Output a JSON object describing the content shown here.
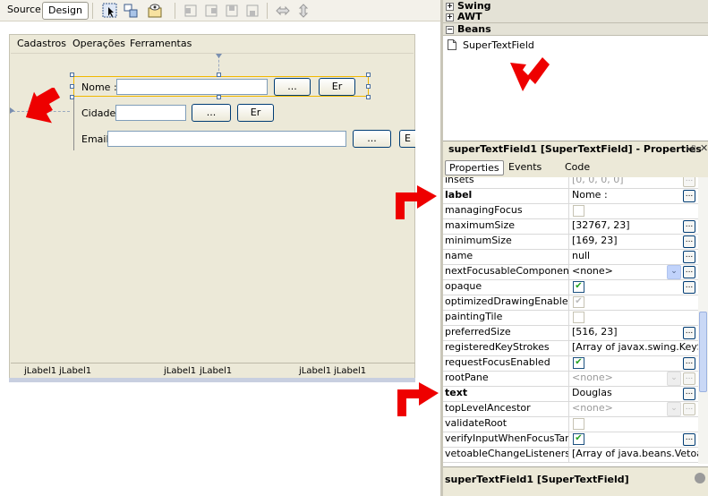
{
  "editor": {
    "tabs": {
      "source": "Source",
      "design": "Design"
    },
    "menu": [
      "Cadastros",
      "Operações",
      "Ferramentas"
    ],
    "form": {
      "rows": [
        {
          "label": "Nome :",
          "button1": "...",
          "button2": "Er"
        },
        {
          "label": "Cidade",
          "button1": "...",
          "button2": "Er"
        },
        {
          "label": "Email",
          "button1": "...",
          "button2": "E"
        }
      ]
    },
    "footer_labels": [
      "jLabel1",
      "jLabel1",
      "jLabel1",
      "jLabel1",
      "jLabel1",
      "jLabel1"
    ]
  },
  "palette": {
    "categories": [
      "Swing",
      "AWT",
      "Beans"
    ],
    "bean_item": "SuperTextField"
  },
  "properties": {
    "title": "superTextField1 [SuperTextField] - Properties",
    "tabs": [
      "Properties",
      "Events",
      "Code"
    ],
    "rows": [
      {
        "name": "insets",
        "value": "[0, 0, 0, 0]",
        "kind": "text",
        "ro": true,
        "ell": true
      },
      {
        "name": "label",
        "value": "Nome :",
        "kind": "text",
        "bold": true,
        "ell": true
      },
      {
        "name": "managingFocus",
        "value": "",
        "kind": "check",
        "checked": false,
        "disabled": true
      },
      {
        "name": "maximumSize",
        "value": "[32767, 23]",
        "kind": "text",
        "ell": true
      },
      {
        "name": "minimumSize",
        "value": "[169, 23]",
        "kind": "text",
        "ell": true
      },
      {
        "name": "name",
        "value": "null",
        "kind": "text",
        "ell": true
      },
      {
        "name": "nextFocusableComponent",
        "value": "<none>",
        "kind": "combo",
        "ell": true
      },
      {
        "name": "opaque",
        "value": "",
        "kind": "check",
        "checked": true,
        "ell": true
      },
      {
        "name": "optimizedDrawingEnabled",
        "value": "",
        "kind": "check",
        "checked": true,
        "disabled": true
      },
      {
        "name": "paintingTile",
        "value": "",
        "kind": "check",
        "checked": false,
        "disabled": true
      },
      {
        "name": "preferredSize",
        "value": "[516, 23]",
        "kind": "text",
        "ell": true
      },
      {
        "name": "registeredKeyStrokes",
        "value": "[Array of javax.swing.KeySt",
        "kind": "text",
        "ro": false
      },
      {
        "name": "requestFocusEnabled",
        "value": "",
        "kind": "check",
        "checked": true,
        "ell": true
      },
      {
        "name": "rootPane",
        "value": "<none>",
        "kind": "combo",
        "ro": true,
        "ell": true
      },
      {
        "name": "text",
        "value": "Douglas",
        "kind": "text",
        "bold": true,
        "ell": true
      },
      {
        "name": "topLevelAncestor",
        "value": "<none>",
        "kind": "combo",
        "ro": true,
        "ell": true
      },
      {
        "name": "validateRoot",
        "value": "",
        "kind": "check",
        "checked": false,
        "disabled": true
      },
      {
        "name": "verifyInputWhenFocusTarget",
        "value": "",
        "kind": "check",
        "checked": true,
        "ell": true
      },
      {
        "name": "vetoableChangeListeners",
        "value": "[Array of java.beans.Vetoab",
        "kind": "text"
      }
    ]
  },
  "status": "superTextField1 [SuperTextField]",
  "colors": {
    "arrow": "#ee0000",
    "selection": "#f0b800"
  }
}
